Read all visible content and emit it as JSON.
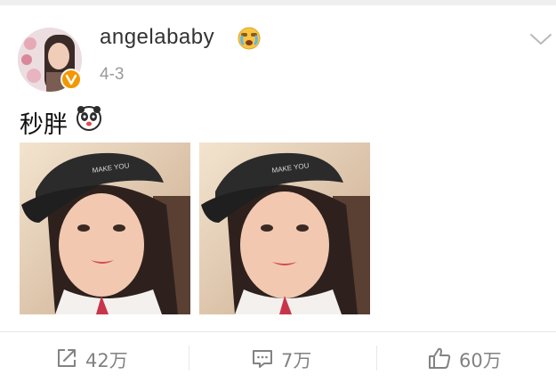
{
  "post": {
    "username": "angelababy",
    "timestamp": "4-3",
    "text": "秒胖",
    "emoji_after_name": "crying-face-icon",
    "emoji_after_text": "panda-face-icon",
    "photos": [
      {
        "description_icon": "selfie-photo"
      },
      {
        "description_icon": "selfie-photo"
      }
    ]
  },
  "actions": {
    "repost_count": "42万",
    "comment_count": "7万",
    "like_count": "60万"
  },
  "colors": {
    "verified_badge": "#f39800",
    "action_text": "#828282",
    "timestamp": "#9a9a9a"
  }
}
